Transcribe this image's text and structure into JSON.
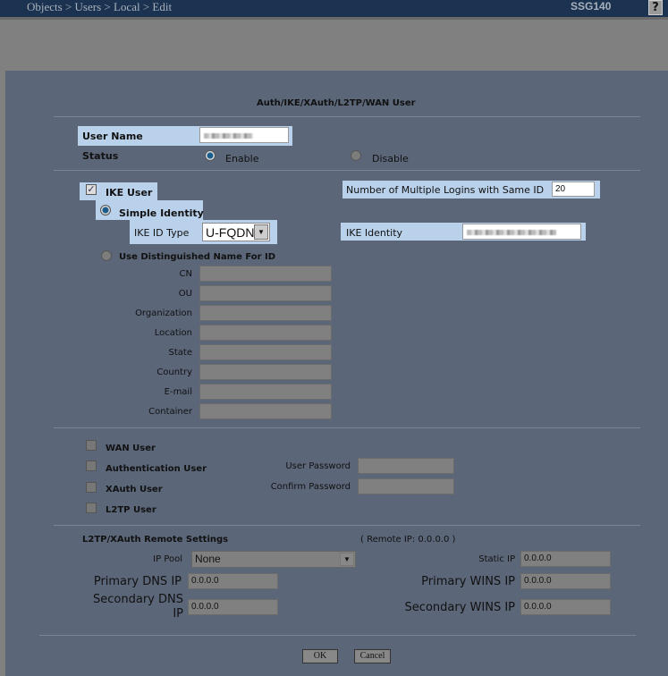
{
  "header": {
    "breadcrumb": "Objects > Users > Local > Edit",
    "model": "SSG140",
    "help": "?"
  },
  "form": {
    "title": "Auth/IKE/XAuth/L2TP/WAN User",
    "user_name_label": "User Name",
    "status_label": "Status",
    "enable": "Enable",
    "disable": "Disable",
    "ike_user": "IKE User",
    "multi_login_label": "Number of Multiple Logins with Same ID",
    "multi_login_value": "20",
    "simple_identity": "Simple Identity",
    "ike_id_type_label": "IKE ID Type",
    "ike_id_type_value": "U-FQDN",
    "ike_identity_label": "IKE Identity",
    "use_dn": "Use Distinguished Name For ID",
    "dn_fields": [
      "CN",
      "OU",
      "Organization",
      "Location",
      "State",
      "Country",
      "E-mail",
      "Container"
    ],
    "wan_user": "WAN User",
    "auth_user": "Authentication User",
    "xauth_user": "XAuth User",
    "l2tp_user": "L2TP User",
    "user_password": "User Password",
    "confirm_password": "Confirm Password",
    "remote_title": "L2TP/XAuth Remote Settings",
    "remote_ip": "( Remote IP: 0.0.0.0 )",
    "ip_pool_label": "IP Pool",
    "ip_pool_value": "None",
    "static_ip_label": "Static IP",
    "static_ip": "0.0.0.0",
    "primary_dns_label": "Primary DNS IP",
    "primary_dns": "0.0.0.0",
    "secondary_dns_label": "Secondary DNS IP",
    "secondary_dns": "0.0.0.0",
    "primary_wins_label": "Primary WINS IP",
    "primary_wins": "0.0.0.0",
    "secondary_wins_label": "Secondary WINS IP",
    "secondary_wins": "0.0.0.0",
    "ok": "OK",
    "cancel": "Cancel"
  }
}
